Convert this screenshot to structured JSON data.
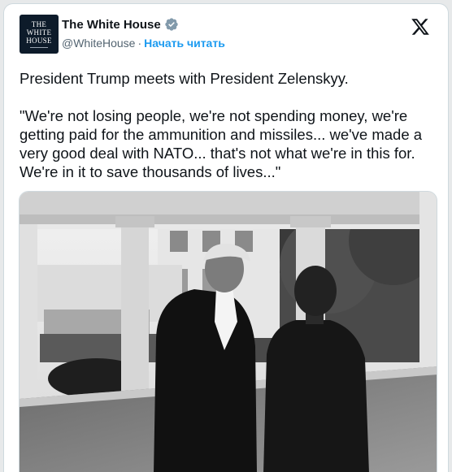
{
  "post": {
    "author": {
      "display_name": "The White House",
      "handle": "@WhiteHouse",
      "separator": "·",
      "follow_label": "Начать читать",
      "avatar_text": [
        "THE",
        "WHITE",
        "HOUSE"
      ]
    },
    "text": "President Trump meets with President Zelenskyy.\n\n\"We're not losing people, we're not spending money, we're getting paid for the ammunition and missiles... we've made a very good deal with NATO... that's not what we're in this for. We're in it to save thousands of lives...\"",
    "icons": {
      "verified": "verified-badge-icon",
      "platform": "x-logo-icon"
    },
    "photo": {
      "style": "black-and-white",
      "subject": "two men standing under a colonnade"
    }
  },
  "colors": {
    "link": "#1d9bf0",
    "text": "#0f1419",
    "secondary": "#536471",
    "avatar_bg": "#0d1b2a"
  }
}
